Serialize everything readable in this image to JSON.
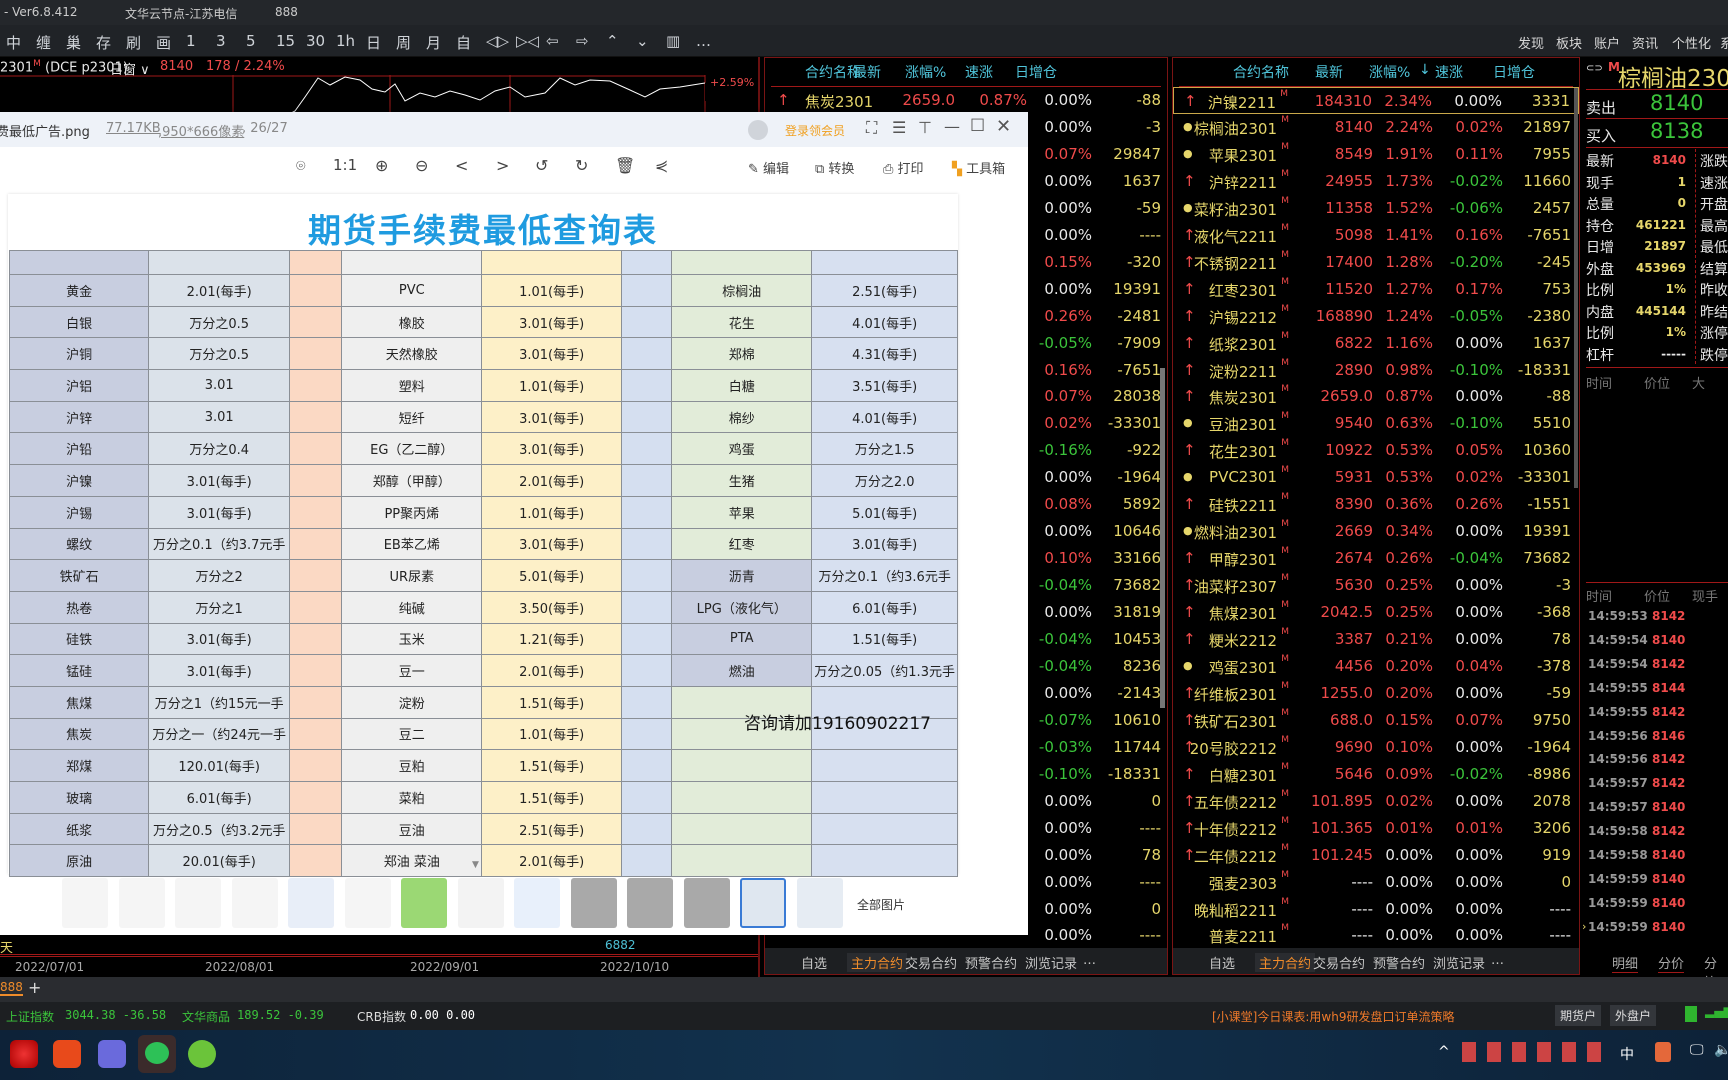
{
  "titlebar": {
    "version": "- Ver6.8.412",
    "node": "文华云节点-江苏电信",
    "account": "888"
  },
  "toolbar": {
    "tools": [
      "中",
      "缠",
      "巢",
      "存",
      "刷",
      "画"
    ],
    "periods": [
      "1",
      "3",
      "5",
      "15",
      "30",
      "1h",
      "日",
      "周",
      "月",
      "自"
    ],
    "nav": [
      "◁▷",
      "▷◁",
      "⇦",
      "⇨",
      "⌃",
      "⌄",
      "▥",
      "…"
    ],
    "menu": [
      "发现",
      "板块",
      "账户",
      "资讯",
      "个性化",
      "系"
    ]
  },
  "chart": {
    "symbol": "2301",
    "symbol_mark": "M",
    "exchange": "(DCE p2301)",
    "window": "日窗",
    "last": "8140",
    "change": "178 / 2.24%",
    "max_label": "+2.59%",
    "period_label": "天",
    "volume_label": "6882",
    "dates": [
      "2022/07/01",
      "2022/08/01",
      "2022/09/01",
      "2022/10/10"
    ]
  },
  "list_headers": {
    "name": "合约名称",
    "last": "最新",
    "chg": "涨幅%",
    "speed": "速涨",
    "oi": "日增仓"
  },
  "mid_list": {
    "first": {
      "arrow": "↑",
      "name": "焦炭2301",
      "last": "2659.0",
      "chg": "0.87%",
      "speed": "0.00%",
      "oi": "-88"
    },
    "rows": [
      [
        "0.00%",
        "-3"
      ],
      [
        "0.07%",
        "29847"
      ],
      [
        "0.00%",
        "1637"
      ],
      [
        "0.00%",
        "-59"
      ],
      [
        "0.00%",
        "----"
      ],
      [
        "0.15%",
        "-320"
      ],
      [
        "0.00%",
        "19391"
      ],
      [
        "0.26%",
        "-2481"
      ],
      [
        "-0.05%",
        "-7909"
      ],
      [
        "0.16%",
        "-7651"
      ],
      [
        "0.07%",
        "28038"
      ],
      [
        "0.02%",
        "-33301"
      ],
      [
        "-0.16%",
        "-922"
      ],
      [
        "0.00%",
        "-1964"
      ],
      [
        "0.08%",
        "5892"
      ],
      [
        "0.00%",
        "10646"
      ],
      [
        "0.10%",
        "33166"
      ],
      [
        "-0.04%",
        "73682"
      ],
      [
        "0.00%",
        "31819"
      ],
      [
        "-0.04%",
        "10453"
      ],
      [
        "-0.04%",
        "8236"
      ],
      [
        "0.00%",
        "-2143"
      ],
      [
        "-0.07%",
        "10610"
      ],
      [
        "-0.03%",
        "11744"
      ],
      [
        "-0.10%",
        "-18331"
      ],
      [
        "0.00%",
        "0"
      ],
      [
        "0.00%",
        "----"
      ],
      [
        "0.00%",
        "78"
      ],
      [
        "0.00%",
        "----"
      ],
      [
        "0.00%",
        "0"
      ],
      [
        "0.00%",
        "----"
      ]
    ]
  },
  "right_list": {
    "sort_icon": "↓",
    "rows": [
      [
        "up",
        "沪镍2211",
        "184310",
        "2.34%",
        "0.00%",
        "3331"
      ],
      [
        "dot",
        "棕榈油2301",
        "8140",
        "2.24%",
        "0.02%",
        "21897"
      ],
      [
        "dot",
        "苹果2301",
        "8549",
        "1.91%",
        "0.11%",
        "7955"
      ],
      [
        "up",
        "沪锌2211",
        "24955",
        "1.73%",
        "-0.02%",
        "11660"
      ],
      [
        "dot",
        "菜籽油2301",
        "11358",
        "1.52%",
        "-0.06%",
        "2457"
      ],
      [
        "up",
        "液化气2211",
        "5098",
        "1.41%",
        "0.16%",
        "-7651"
      ],
      [
        "up",
        "不锈钢2211",
        "17400",
        "1.28%",
        "-0.20%",
        "-245"
      ],
      [
        "up",
        "红枣2301",
        "11520",
        "1.27%",
        "0.17%",
        "753"
      ],
      [
        "up",
        "沪锡2212",
        "168890",
        "1.24%",
        "-0.05%",
        "-2380"
      ],
      [
        "up",
        "纸浆2301",
        "6822",
        "1.16%",
        "0.00%",
        "1637"
      ],
      [
        "up",
        "淀粉2211",
        "2890",
        "0.98%",
        "-0.10%",
        "-18331"
      ],
      [
        "up",
        "焦炭2301",
        "2659.0",
        "0.87%",
        "0.00%",
        "-88"
      ],
      [
        "dot",
        "豆油2301",
        "9540",
        "0.63%",
        "-0.10%",
        "5510"
      ],
      [
        "up",
        "花生2301",
        "10922",
        "0.53%",
        "0.05%",
        "10360"
      ],
      [
        "dot",
        "PVC2301",
        "5931",
        "0.53%",
        "0.02%",
        "-33301"
      ],
      [
        "up",
        "硅铁2211",
        "8390",
        "0.36%",
        "0.26%",
        "-1551"
      ],
      [
        "dot",
        "燃料油2301",
        "2669",
        "0.34%",
        "0.00%",
        "19391"
      ],
      [
        "up",
        "甲醇2301",
        "2674",
        "0.26%",
        "-0.04%",
        "73682"
      ],
      [
        "up",
        "油菜籽2307",
        "5630",
        "0.25%",
        "0.00%",
        "-3"
      ],
      [
        "up",
        "焦煤2301",
        "2042.5",
        "0.25%",
        "0.00%",
        "-368"
      ],
      [
        "up",
        "粳米2212",
        "3387",
        "0.21%",
        "0.00%",
        "78"
      ],
      [
        "dot",
        "鸡蛋2301",
        "4456",
        "0.20%",
        "0.04%",
        "-378"
      ],
      [
        "up",
        "纤维板2301",
        "1255.0",
        "0.20%",
        "0.00%",
        "-59"
      ],
      [
        "up",
        "铁矿石2301",
        "688.0",
        "0.15%",
        "0.07%",
        "9750"
      ],
      [
        "up",
        "20号胶2212",
        "9690",
        "0.10%",
        "0.00%",
        "-1964"
      ],
      [
        "up",
        "白糖2301",
        "5646",
        "0.09%",
        "-0.02%",
        "-8986"
      ],
      [
        "up",
        "五年债2212",
        "101.895",
        "0.02%",
        "0.00%",
        "2078"
      ],
      [
        "up",
        "十年债2212",
        "101.365",
        "0.01%",
        "0.01%",
        "3206"
      ],
      [
        "up",
        "二年债2212",
        "101.245",
        "0.00%",
        "0.00%",
        "919"
      ],
      [
        "",
        "强麦2303",
        "----",
        "0.00%",
        "0.00%",
        "0"
      ],
      [
        "",
        "晚籼稻2211",
        "----",
        "0.00%",
        "0.00%",
        "----"
      ],
      [
        "",
        "普麦2211",
        "----",
        "0.00%",
        "0.00%",
        "----"
      ]
    ]
  },
  "list_tabs": [
    "自选",
    "主力合约",
    "交易合约",
    "预警合约",
    "浏览记录",
    "…"
  ],
  "quote": {
    "title": "棕榈油230",
    "mark": "M",
    "sell_label": "卖出",
    "sell": "8140",
    "buy_label": "买入",
    "buy": "8138",
    "stats": [
      [
        "最新",
        "8140"
      ],
      [
        "现手",
        "1"
      ],
      [
        "总量",
        "0"
      ],
      [
        "持仓",
        "461221"
      ],
      [
        "日增",
        "21897"
      ],
      [
        "外盘",
        "453969"
      ],
      [
        "比例",
        "1%"
      ],
      [
        "内盘",
        "445144"
      ],
      [
        "比例",
        "1%"
      ],
      [
        "杠杆",
        "-----"
      ]
    ],
    "right_labels": [
      "涨跌",
      "速涨",
      "开盘",
      "最高",
      "最低",
      "结算",
      "昨收",
      "昨结",
      "涨停",
      "跌停"
    ],
    "hdr1": [
      "时间",
      "价位",
      "大"
    ],
    "hdr2": [
      "时间",
      "价位",
      "现手"
    ],
    "ticks": [
      [
        "14:59:53",
        "8142"
      ],
      [
        "14:59:54",
        "8140"
      ],
      [
        "14:59:54",
        "8142"
      ],
      [
        "14:59:55",
        "8144"
      ],
      [
        "14:59:55",
        "8142"
      ],
      [
        "14:59:56",
        "8146"
      ],
      [
        "14:59:56",
        "8142"
      ],
      [
        "14:59:57",
        "8142"
      ],
      [
        "14:59:57",
        "8140"
      ],
      [
        "14:59:58",
        "8142"
      ],
      [
        "14:59:58",
        "8140"
      ],
      [
        "14:59:59",
        "8140"
      ],
      [
        "14:59:59",
        "8140"
      ],
      [
        "14:59:59",
        "8140"
      ]
    ],
    "tabs": [
      "明细",
      "分价",
      "分笔"
    ]
  },
  "viewer": {
    "filename": "费最低广告.png",
    "size": "77.17KB",
    "dims": ",950*666像素",
    "index": ", 26/27",
    "login": "登录领会员",
    "tools": [
      "1:1"
    ],
    "actions": {
      "edit": "编辑",
      "convert": "转换",
      "print": "打印",
      "toolbox": "工具箱"
    },
    "all_images": "全部图片",
    "doc_title": "期货手续费最低查询表",
    "contact": "咨询请加19160902217",
    "rows": [
      [
        "黄金",
        "2.01(每手)",
        "PVC",
        "1.01(每手)",
        "棕榈油",
        "2.51(每手)"
      ],
      [
        "白银",
        "万分之0.5",
        "橡胶",
        "3.01(每手)",
        "花生",
        "4.01(每手)"
      ],
      [
        "沪铜",
        "万分之0.5",
        "天然橡胶",
        "3.01(每手)",
        "郑棉",
        "4.31(每手)"
      ],
      [
        "沪铝",
        "3.01",
        "塑料",
        "1.01(每手)",
        "白糖",
        "3.51(每手)"
      ],
      [
        "沪锌",
        "3.01",
        "短纤",
        "3.01(每手)",
        "棉纱",
        "4.01(每手)"
      ],
      [
        "沪铅",
        "万分之0.4",
        "EG（乙二醇）",
        "3.01(每手)",
        "鸡蛋",
        "万分之1.5"
      ],
      [
        "沪镍",
        "3.01(每手)",
        "郑醇（甲醇）",
        "2.01(每手)",
        "生猪",
        "万分之2.0"
      ],
      [
        "沪锡",
        "3.01(每手)",
        "PP聚丙烯",
        "1.01(每手)",
        "苹果",
        "5.01(每手)"
      ],
      [
        "螺纹",
        "万分之0.1（约3.7元手",
        "EB苯乙烯",
        "3.01(每手)",
        "红枣",
        "3.01(每手)"
      ],
      [
        "铁矿石",
        "万分之2",
        "UR尿素",
        "5.01(每手)",
        "沥青",
        "万分之0.1（约3.6元手"
      ],
      [
        "热卷",
        "万分之1",
        "纯碱",
        "3.50(每手)",
        "LPG（液化气）",
        "6.01(每手)"
      ],
      [
        "硅铁",
        "3.01(每手)",
        "玉米",
        "1.21(每手)",
        "PTA",
        "1.51(每手)"
      ],
      [
        "锰硅",
        "3.01(每手)",
        "豆一",
        "2.01(每手)",
        "燃油",
        "万分之0.05（约1.3元手"
      ],
      [
        "焦煤",
        "万分之1（约15元一手",
        "淀粉",
        "1.51(每手)",
        "",
        ""
      ],
      [
        "焦炭",
        "万分之一（约24元一手",
        "豆二",
        "1.01(每手)",
        "",
        ""
      ],
      [
        "郑煤",
        "120.01(每手)",
        "豆粕",
        "1.51(每手)",
        "",
        ""
      ],
      [
        "玻璃",
        "6.01(每手)",
        "菜粕",
        "1.51(每手)",
        "",
        ""
      ],
      [
        "纸浆",
        "万分之0.5（约3.2元手",
        "豆油",
        "2.51(每手)",
        "",
        ""
      ],
      [
        "原油",
        "20.01(每手)",
        "郑油 菜油",
        "2.01(每手)",
        "",
        ""
      ]
    ]
  },
  "tabbar": {
    "tab": "888",
    "add": "+"
  },
  "status": {
    "sh_label": "上证指数",
    "sh": "3044.38 -36.58",
    "wh_label": "文华商品",
    "wh": "189.52 -0.39",
    "crb_label": "CRB指数",
    "crb": "0.00 0.00",
    "notice": "[小课堂]今日课表:用wh9研发盘口订单流策略",
    "btn1": "期货户",
    "btn2": "外盘户"
  },
  "taskbar": {
    "ime": "中"
  },
  "colors": {
    "up": "#f04b4b",
    "down": "#3bc43b",
    "oi": "#e6d66b",
    "header": "#4fc3d9",
    "accent": "#ff8c1a",
    "title_blue": "#1f9be0"
  }
}
